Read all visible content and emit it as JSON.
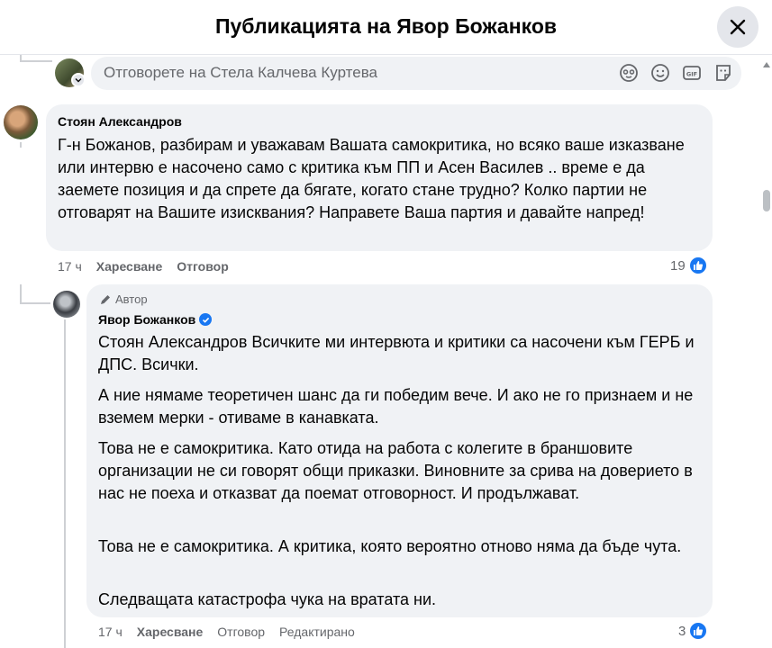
{
  "header": {
    "title": "Публикацията на Явор Божанков"
  },
  "reply_box": {
    "placeholder": "Отговорете на Стела Калчева Куртева",
    "icons": [
      "avatar-icon",
      "emoji-icon",
      "gif-icon",
      "sticker-icon"
    ]
  },
  "comments": [
    {
      "author": "Стоян Александров",
      "text": "Г-н Божанов, разбирам и уважавам Вашата самокритика, но всяко ваше изказване или интервю е насочено само с критика към ПП и Асен Василев .. време е да заемете позиция и да спрете да бягате, когато стане трудно? Колко партии не отговарят на Вашите изисквания? Направете Ваша партия и давайте напред!",
      "time": "17 ч",
      "like_label": "Харесване",
      "reply_label": "Отговор",
      "reactions": "19"
    },
    {
      "badge": "Автор",
      "author": "Явор Божанков",
      "paragraphs": [
        "Стоян Александров Всичките ми интервюта и критики са насочени към ГЕРБ и ДПС. Всички.",
        "А ние нямаме теоретичен шанс да ги победим вече. И ако не го признаем и не вземем мерки - отиваме в канавката.",
        "Това не е самокритика. Като отида на работа с колегите в браншовите организации не си говорят общи приказки. Виновните за срива на доверието в нас не поеха и отказват да поемат отговорност. И продължават.",
        "Това не е самокритика. А критика, която вероятно отново няма да бъде чута.",
        "Следващата катастрофа чука на вратата ни."
      ],
      "time": "17 ч",
      "like_label": "Харесване",
      "reply_label": "Отговор",
      "edited_label": "Редактирано",
      "reactions": "3"
    }
  ],
  "colors": {
    "accent": "#1877f2",
    "bubble": "#f0f2f5",
    "secondary_text": "#65676b"
  }
}
